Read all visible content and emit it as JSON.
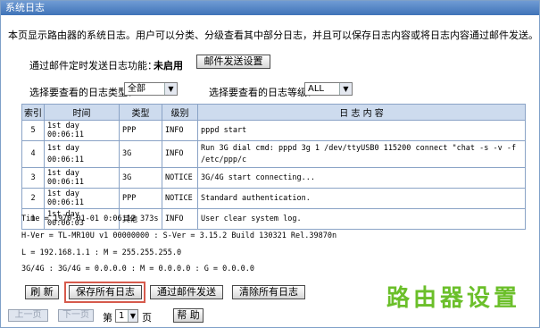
{
  "window": {
    "title": "系统日志"
  },
  "description": "本页显示路由器的系统日志。用户可以分类、分级查看其中部分日志，并且可以保存日志内容或将日志内容通过邮件发送。",
  "mail": {
    "label": "通过邮件定时发送日志功能：",
    "status": "未启用",
    "settings_button": "邮件发送设置"
  },
  "filters": {
    "type_label": "选择要查看的日志类型：",
    "type_value": "全部",
    "level_label": "选择要查看的日志等级：",
    "level_value": "ALL"
  },
  "table": {
    "headers": [
      "索引",
      "时间",
      "类型",
      "级别",
      "日 志 内 容"
    ],
    "rows": [
      [
        "5",
        "1st day 00:06:11",
        "PPP",
        "INFO",
        "pppd start"
      ],
      [
        "4",
        "1st day 00:06:11",
        "3G",
        "INFO",
        "Run 3G dial cmd: pppd 3g 1 /dev/ttyUSB0 115200 connect \"chat -s -v -f /etc/ppp/c"
      ],
      [
        "3",
        "1st day 00:06:11",
        "3G",
        "NOTICE",
        "3G/4G start connecting..."
      ],
      [
        "2",
        "1st day 00:06:11",
        "PPP",
        "NOTICE",
        "Standard authentication."
      ],
      [
        "1",
        "1st day 00:06:03",
        "其他",
        "INFO",
        "User clear system log."
      ]
    ]
  },
  "info": {
    "time": "Time = 1970-01-01 0:06:12 373s",
    "version": "H-Ver = TL-MR10U v1 00000000 : S-Ver = 3.15.2 Build 130321 Rel.39870n",
    "lan": "L = 192.168.1.1 : M = 255.255.255.0",
    "wan": "3G/4G : 3G/4G = 0.0.0.0 : M = 0.0.0.0 : G = 0.0.0.0"
  },
  "actions": {
    "refresh": "刷 新",
    "save_all": "保存所有日志",
    "send_mail": "通过邮件发送",
    "clear_all": "清除所有日志"
  },
  "pager": {
    "prev": "上一页",
    "next": "下一页",
    "page_prefix": "第",
    "page_value": "1",
    "page_suffix": "页",
    "help": "帮 助"
  },
  "brand": "路由器设置"
}
